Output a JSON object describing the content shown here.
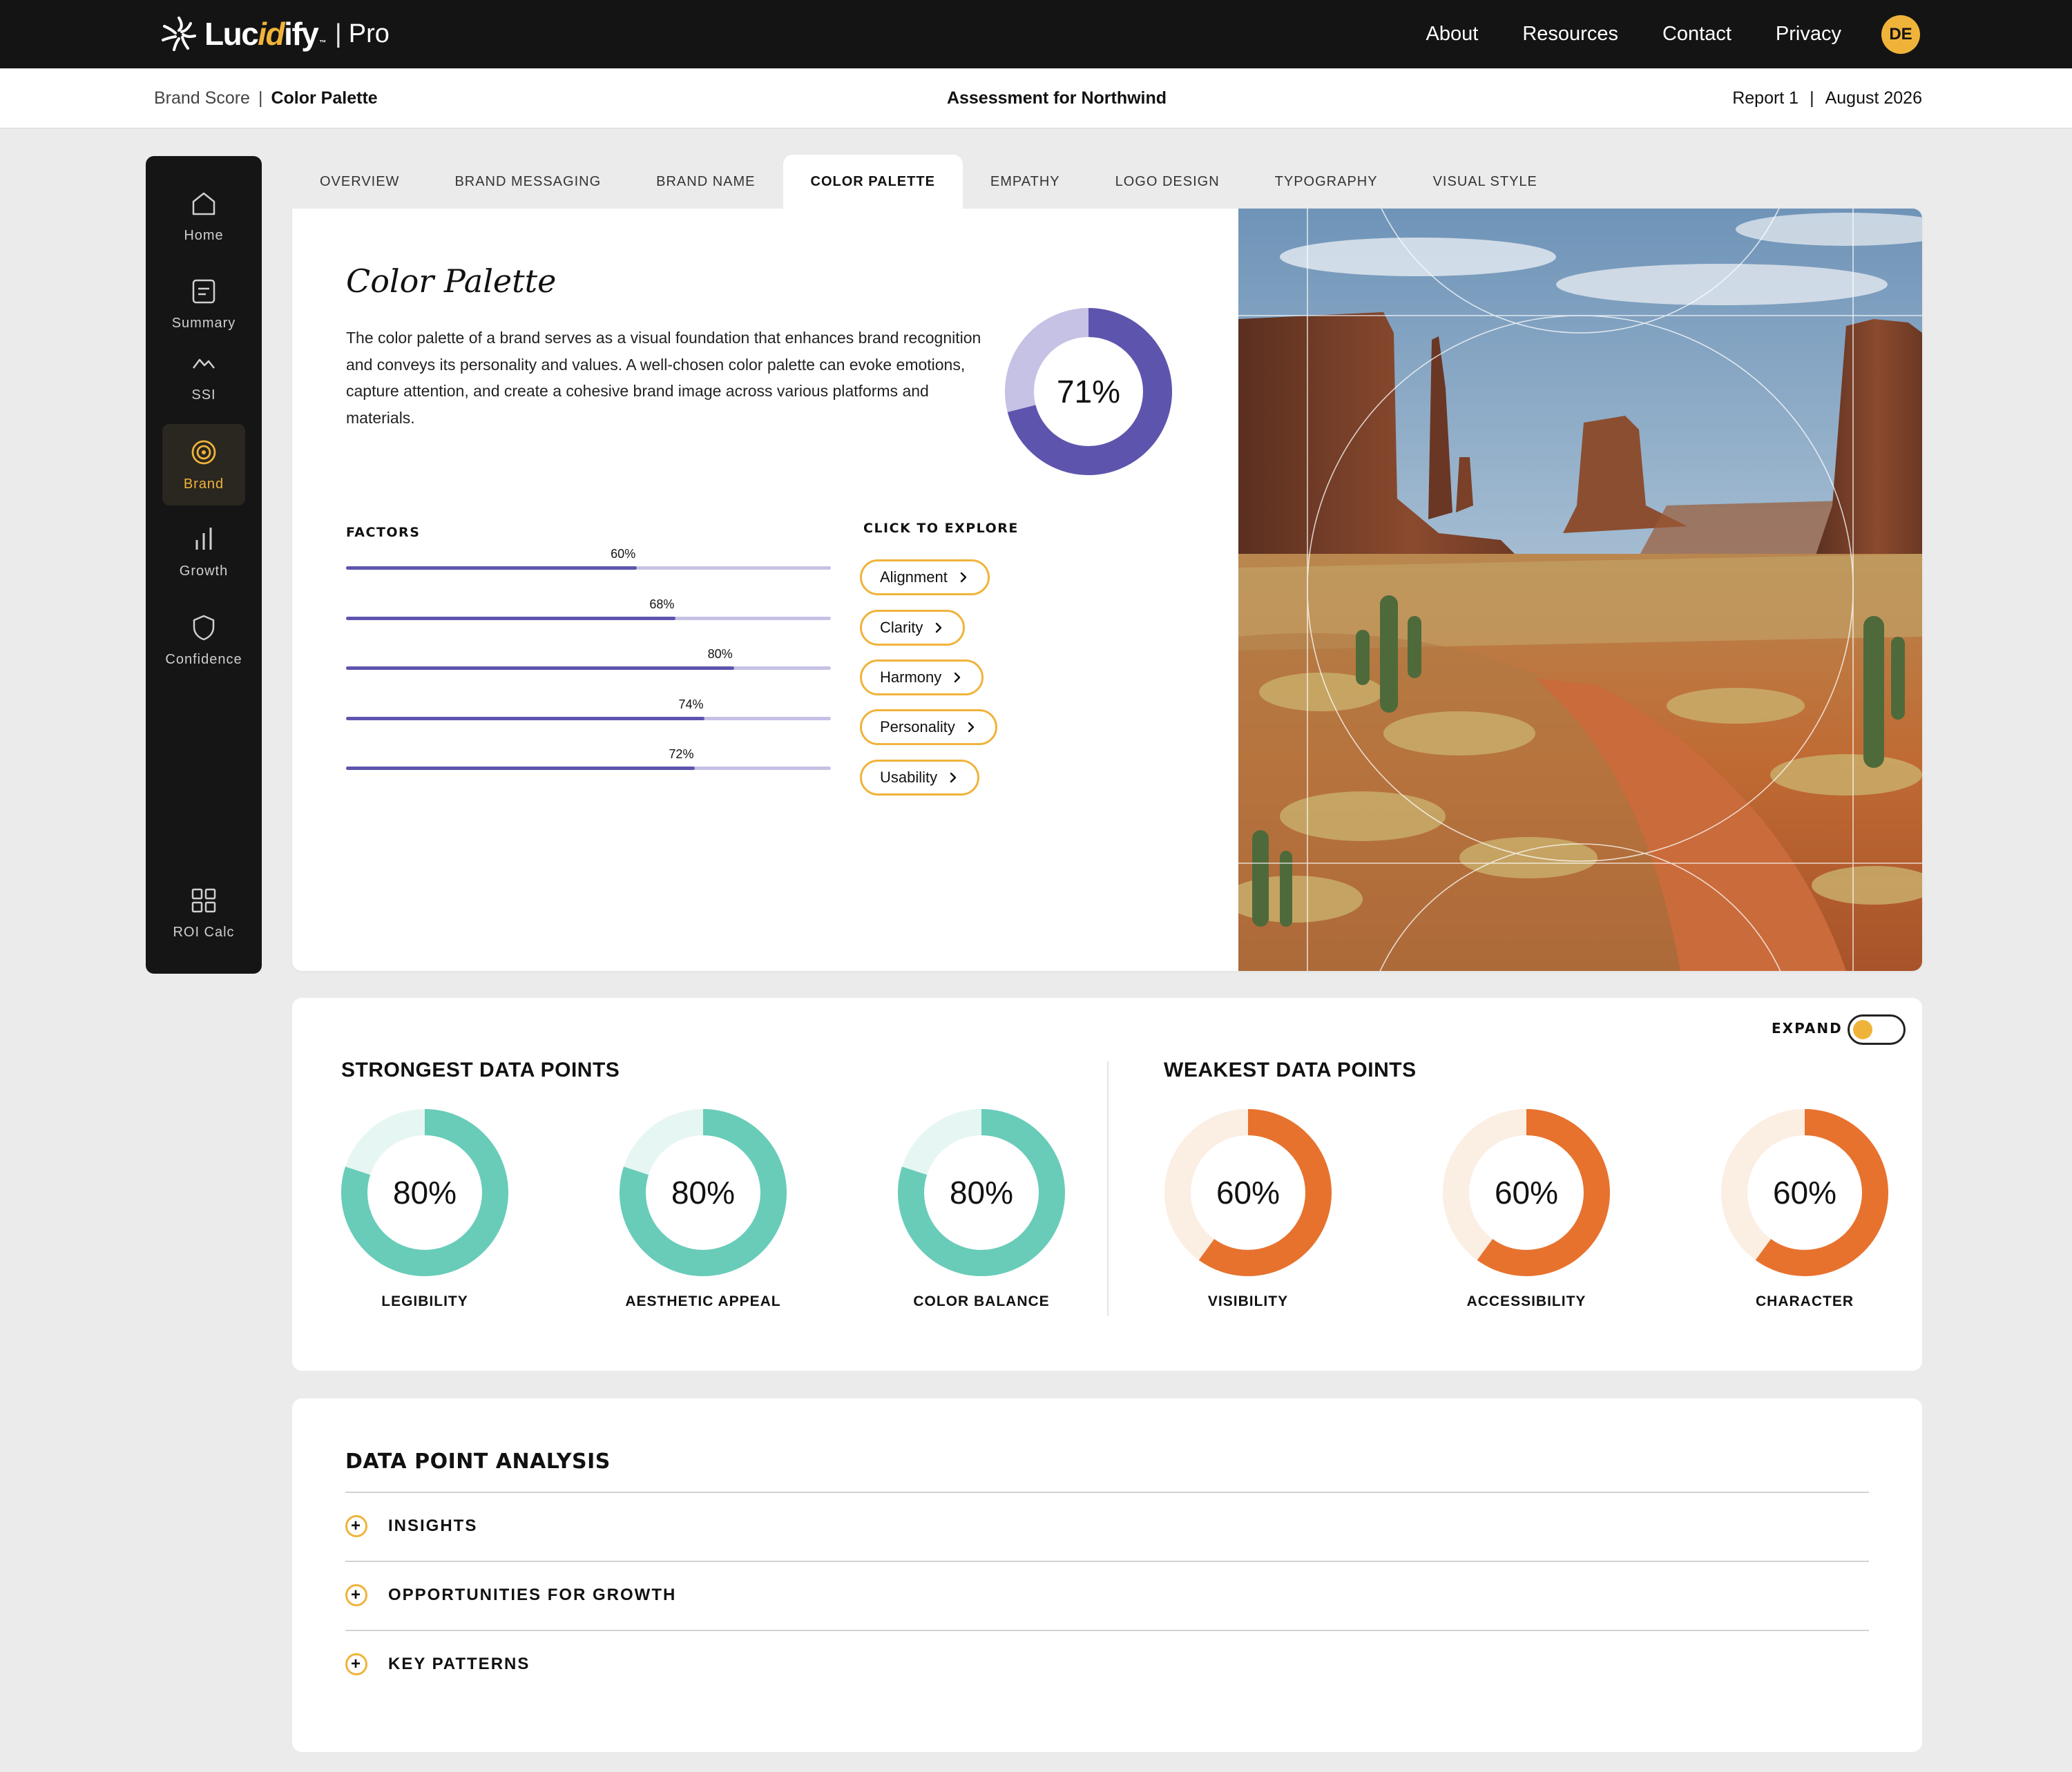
{
  "brand": {
    "name_part1": "Luc",
    "name_accent": "id",
    "name_part2": "ify",
    "tm": "™",
    "product_sep": "|",
    "product": "Pro"
  },
  "topnav": {
    "items": [
      "About",
      "Resources",
      "Contact",
      "Privacy"
    ],
    "avatar_initials": "DE"
  },
  "breadcrumb": {
    "parent": "Brand Score",
    "separator": "|",
    "current": "Color Palette"
  },
  "assessment_title": "Assessment for Northwind",
  "report": {
    "label": "Report 1",
    "separator": "|",
    "date": "August 2026"
  },
  "sidebar": {
    "items": [
      {
        "label": "Home",
        "icon": "home-icon"
      },
      {
        "label": "Summary",
        "icon": "summary-icon"
      },
      {
        "label": "SSI",
        "icon": "ssi-icon"
      },
      {
        "label": "Brand",
        "icon": "target-icon",
        "active": true
      },
      {
        "label": "Growth",
        "icon": "bar-chart-icon"
      },
      {
        "label": "Confidence",
        "icon": "shield-icon"
      },
      {
        "label": "ROI Calc",
        "icon": "grid-icon"
      }
    ]
  },
  "tabs": [
    "OVERVIEW",
    "BRAND MESSAGING",
    "BRAND NAME",
    "COLOR PALETTE",
    "EMPATHY",
    "LOGO DESIGN",
    "TYPOGRAPHY",
    "VISUAL STYLE"
  ],
  "active_tab": "COLOR PALETTE",
  "color_palette": {
    "title": "Color Palette",
    "description": "The color palette of a brand serves as a visual foundation that enhances brand recognition and conveys its personality and values. A well-chosen color palette can evoke emotions, capture attention, and create a cohesive brand image across various platforms and materials.",
    "score": 71,
    "score_label": "71%",
    "factors_heading": "FACTORS",
    "explore_heading": "CLICK TO EXPLORE",
    "factors": [
      {
        "value": 60,
        "label": "60%"
      },
      {
        "value": 68,
        "label": "68%"
      },
      {
        "value": 80,
        "label": "80%"
      },
      {
        "value": 74,
        "label": "74%"
      },
      {
        "value": 72,
        "label": "72%"
      }
    ],
    "explore_links": [
      "Alignment",
      "Clarity",
      "Harmony",
      "Personality",
      "Usability"
    ]
  },
  "data_points": {
    "expand_label": "EXPAND",
    "strongest_heading": "STRONGEST DATA POINTS",
    "weakest_heading": "WEAKEST DATA POINTS",
    "strongest": [
      {
        "label": "LEGIBILITY",
        "value": 80,
        "pct": "80%"
      },
      {
        "label": "AESTHETIC APPEAL",
        "value": 80,
        "pct": "80%"
      },
      {
        "label": "COLOR BALANCE",
        "value": 80,
        "pct": "80%"
      }
    ],
    "weakest": [
      {
        "label": "VISIBILITY",
        "value": 60,
        "pct": "60%"
      },
      {
        "label": "ACCESSIBILITY",
        "value": 60,
        "pct": "60%"
      },
      {
        "label": "CHARACTER",
        "value": 60,
        "pct": "60%"
      }
    ]
  },
  "analysis": {
    "heading": "DATA POINT ANALYSIS",
    "rows": [
      "INSIGHTS",
      "OPPORTUNITIES FOR GROWTH",
      "KEY PATTERNS"
    ]
  },
  "colors": {
    "accent": "#f0b33a",
    "purple": "#5d55ad",
    "purple_light": "#c5c2e5",
    "teal": "#68ccb8",
    "teal_light": "#e6f6f3",
    "orange": "#e7722e",
    "orange_light": "#fbeee3"
  }
}
